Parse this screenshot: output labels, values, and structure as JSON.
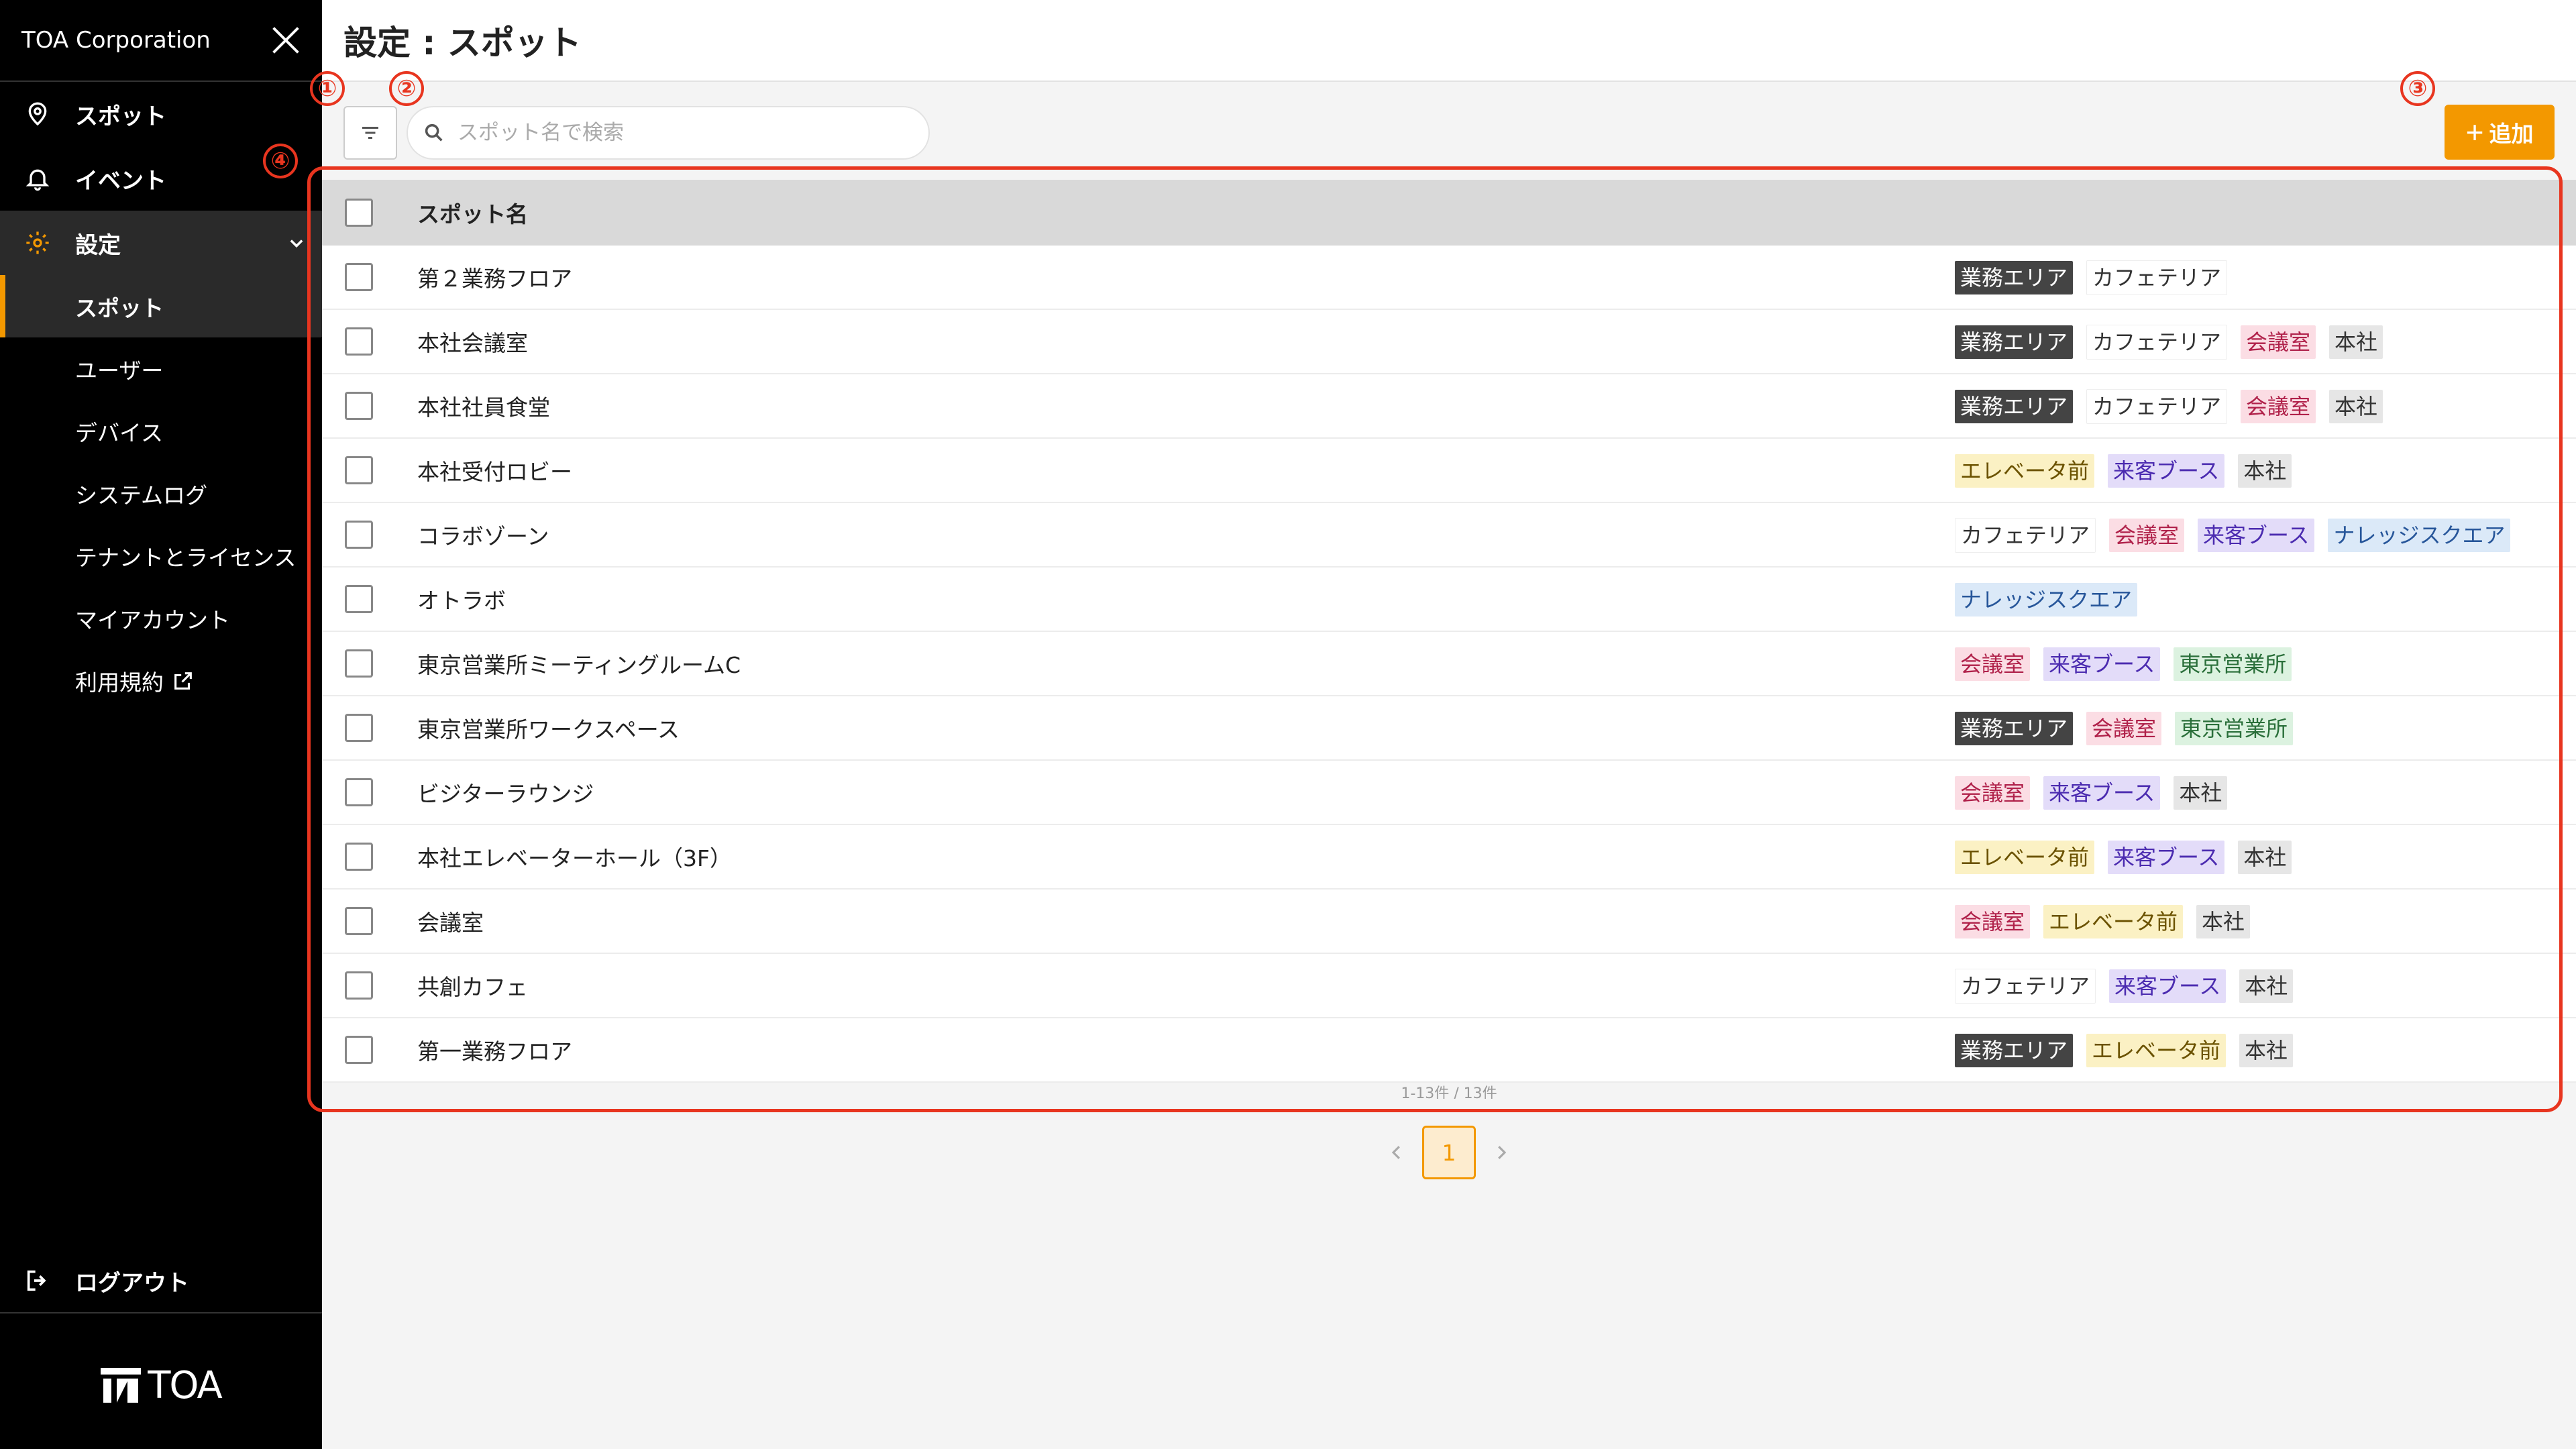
{
  "sidebar": {
    "title": "TOA Corporation",
    "nav": [
      {
        "label": "スポット"
      },
      {
        "label": "イベント"
      },
      {
        "label": "設定"
      }
    ],
    "sub_items": [
      {
        "label": "スポット"
      },
      {
        "label": "ユーザー"
      },
      {
        "label": "デバイス"
      },
      {
        "label": "システムログ"
      },
      {
        "label": "テナントとライセンス"
      },
      {
        "label": "マイアカウント"
      },
      {
        "label": "利用規約"
      }
    ],
    "logout": "ログアウト",
    "logo_text": "TOA"
  },
  "header": {
    "title": "設定 : スポット"
  },
  "toolbar": {
    "search_placeholder": "スポット名で検索",
    "add_label": "追加"
  },
  "table": {
    "column_header": "スポット名",
    "rows": [
      {
        "name": "第２業務フロア",
        "tags": [
          {
            "text": "業務エリア",
            "style": "dark"
          },
          {
            "text": "カフェテリア",
            "style": "plain"
          }
        ]
      },
      {
        "name": "本社会議室",
        "tags": [
          {
            "text": "業務エリア",
            "style": "dark"
          },
          {
            "text": "カフェテリア",
            "style": "plain"
          },
          {
            "text": "会議室",
            "style": "pink"
          },
          {
            "text": "本社",
            "style": "gray"
          }
        ]
      },
      {
        "name": "本社社員食堂",
        "tags": [
          {
            "text": "業務エリア",
            "style": "dark"
          },
          {
            "text": "カフェテリア",
            "style": "plain"
          },
          {
            "text": "会議室",
            "style": "pink"
          },
          {
            "text": "本社",
            "style": "gray"
          }
        ]
      },
      {
        "name": "本社受付ロビー",
        "tags": [
          {
            "text": "エレベータ前",
            "style": "yellow"
          },
          {
            "text": "来客ブース",
            "style": "purple"
          },
          {
            "text": "本社",
            "style": "gray"
          }
        ]
      },
      {
        "name": "コラボゾーン",
        "tags": [
          {
            "text": "カフェテリア",
            "style": "plain"
          },
          {
            "text": "会議室",
            "style": "pink"
          },
          {
            "text": "来客ブース",
            "style": "purple"
          },
          {
            "text": "ナレッジスクエア",
            "style": "blue"
          }
        ]
      },
      {
        "name": "オトラボ",
        "tags": [
          {
            "text": "ナレッジスクエア",
            "style": "blue"
          }
        ]
      },
      {
        "name": "東京営業所ミーティングルームC",
        "tags": [
          {
            "text": "会議室",
            "style": "pink"
          },
          {
            "text": "来客ブース",
            "style": "purple"
          },
          {
            "text": "東京営業所",
            "style": "green"
          }
        ]
      },
      {
        "name": "東京営業所ワークスペース",
        "tags": [
          {
            "text": "業務エリア",
            "style": "dark"
          },
          {
            "text": "会議室",
            "style": "pink"
          },
          {
            "text": "東京営業所",
            "style": "green"
          }
        ]
      },
      {
        "name": "ビジターラウンジ",
        "tags": [
          {
            "text": "会議室",
            "style": "pink"
          },
          {
            "text": "来客ブース",
            "style": "purple"
          },
          {
            "text": "本社",
            "style": "gray"
          }
        ]
      },
      {
        "name": "本社エレベーターホール（3F）",
        "tags": [
          {
            "text": "エレベータ前",
            "style": "yellow"
          },
          {
            "text": "来客ブース",
            "style": "purple"
          },
          {
            "text": "本社",
            "style": "gray"
          }
        ]
      },
      {
        "name": "会議室",
        "tags": [
          {
            "text": "会議室",
            "style": "pink"
          },
          {
            "text": "エレベータ前",
            "style": "yellow"
          },
          {
            "text": "本社",
            "style": "gray"
          }
        ]
      },
      {
        "name": "共創カフェ",
        "tags": [
          {
            "text": "カフェテリア",
            "style": "plain"
          },
          {
            "text": "来客ブース",
            "style": "purple"
          },
          {
            "text": "本社",
            "style": "gray"
          }
        ]
      },
      {
        "name": "第一業務フロア",
        "tags": [
          {
            "text": "業務エリア",
            "style": "dark"
          },
          {
            "text": "エレベータ前",
            "style": "yellow"
          },
          {
            "text": "本社",
            "style": "gray"
          }
        ]
      }
    ],
    "count_text": "1-13件 / 13件"
  },
  "pagination": {
    "current_page": "1"
  },
  "annotations": [
    "①",
    "②",
    "③",
    "④"
  ],
  "colors": {
    "accent": "#f39800",
    "annotation": "#e8351f",
    "sidebar_bg": "#000000"
  }
}
